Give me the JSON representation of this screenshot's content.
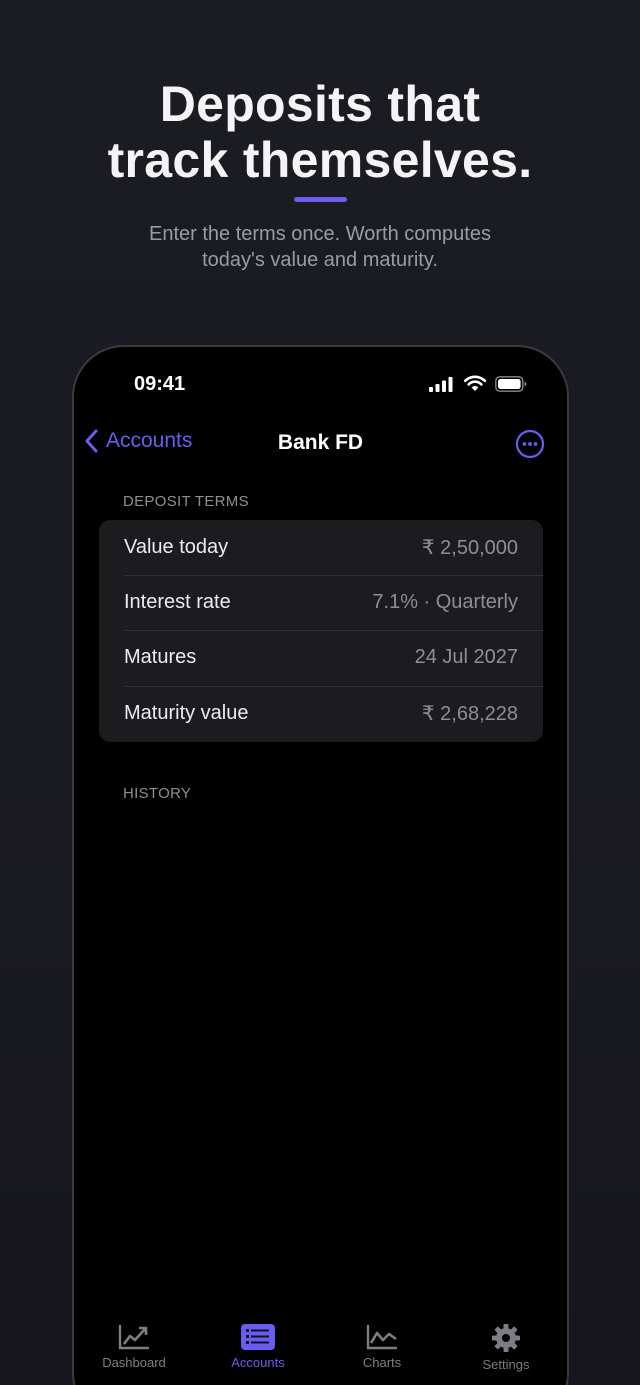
{
  "hero": {
    "title_line1": "Deposits that",
    "title_line2": "track themselves.",
    "subtitle_line1": "Enter the terms once. Worth computes",
    "subtitle_line2": "today's value and maturity.",
    "accent_color": "#6a5cf0"
  },
  "status_bar": {
    "time": "09:41",
    "icons": [
      "signal-icon",
      "wifi-icon",
      "battery-icon"
    ]
  },
  "nav": {
    "back_label": "Accounts",
    "title": "Bank FD",
    "more_icon": "ellipsis-circle-icon"
  },
  "deposit_terms": {
    "header": "DEPOSIT TERMS",
    "rows": [
      {
        "label": "Value today",
        "value": "₹ 2,50,000"
      },
      {
        "label": "Interest rate",
        "value": "7.1% · Quarterly"
      },
      {
        "label": "Matures",
        "value": "24 Jul 2027"
      },
      {
        "label": "Maturity value",
        "value": "₹ 2,68,228"
      }
    ]
  },
  "history": {
    "header": "HISTORY"
  },
  "tabbar": {
    "active": "Accounts",
    "tabs": [
      {
        "label": "Dashboard",
        "icon": "trend-chart-icon"
      },
      {
        "label": "Accounts",
        "icon": "list-icon"
      },
      {
        "label": "Charts",
        "icon": "line-chart-icon"
      },
      {
        "label": "Settings",
        "icon": "gear-icon"
      }
    ]
  }
}
